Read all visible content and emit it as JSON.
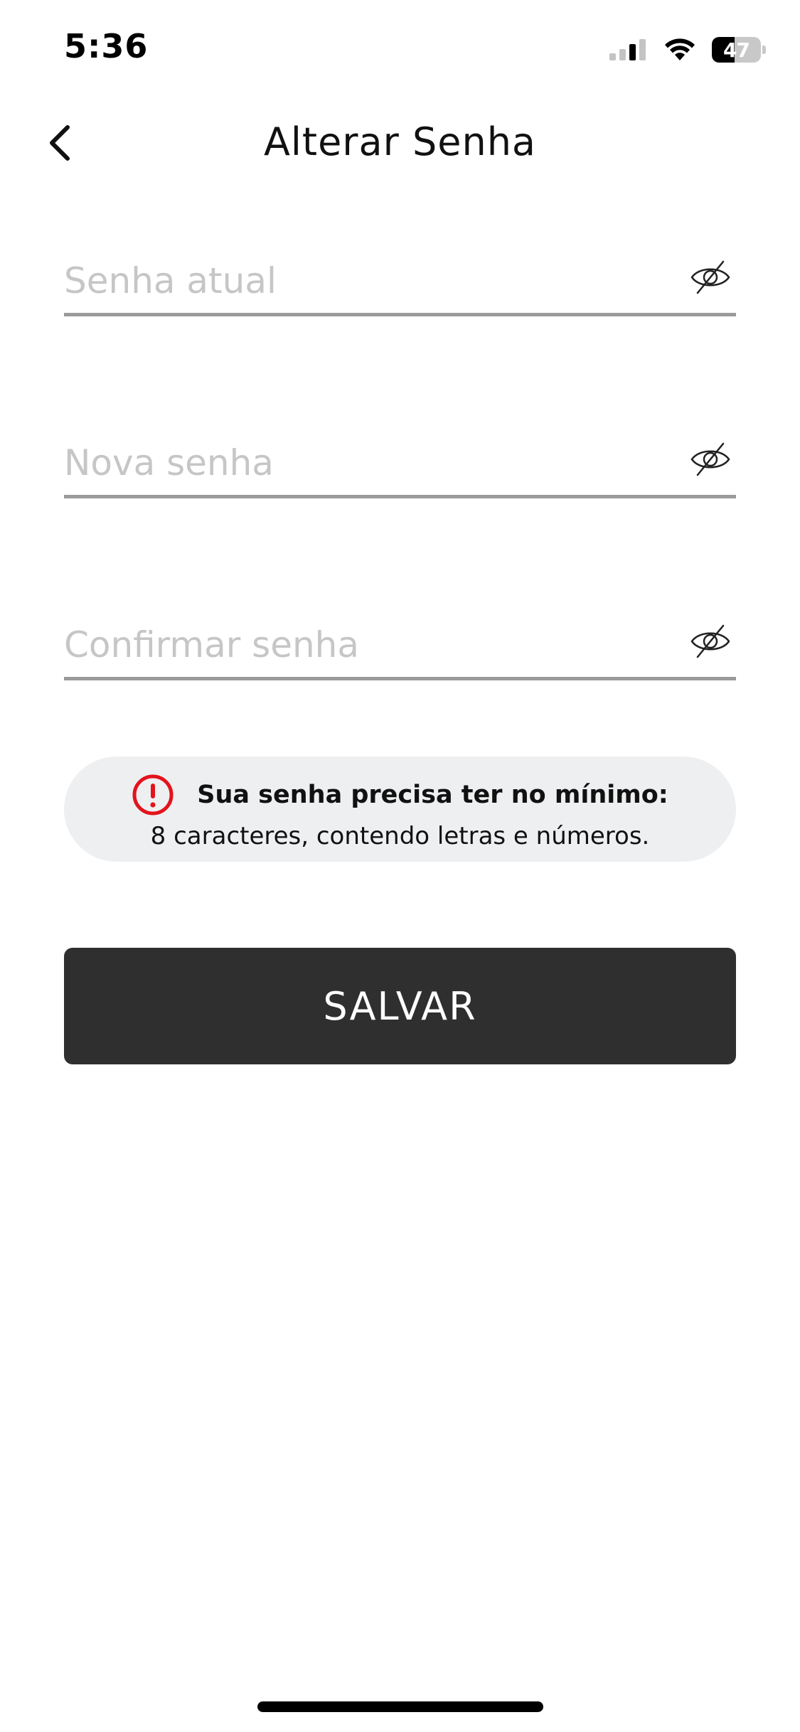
{
  "status_bar": {
    "time": "5:36",
    "battery_level": "47",
    "battery_fraction": 0.47,
    "icons": [
      "signal-icon",
      "wifi-icon",
      "battery-icon"
    ]
  },
  "header": {
    "title": "Alterar Senha",
    "back_icon": "chevron-left-icon"
  },
  "form": {
    "fields": [
      {
        "placeholder": "Senha atual",
        "value": "",
        "toggle_icon": "eye-off-icon"
      },
      {
        "placeholder": "Nova senha",
        "value": "",
        "toggle_icon": "eye-off-icon"
      },
      {
        "placeholder": "Confirmar senha",
        "value": "",
        "toggle_icon": "eye-off-icon"
      }
    ]
  },
  "info": {
    "icon": "alert-circle-icon",
    "title": "Sua senha precisa ter no mínimo:",
    "text": "8 caracteres, contendo letras e números."
  },
  "actions": {
    "save_label": "SALVAR"
  },
  "colors": {
    "alert": "#e3131b",
    "button_bg": "#2f2f2f",
    "info_bg": "#eeeff1",
    "underline": "#9a9a9a",
    "placeholder": "#c6c6c6"
  }
}
